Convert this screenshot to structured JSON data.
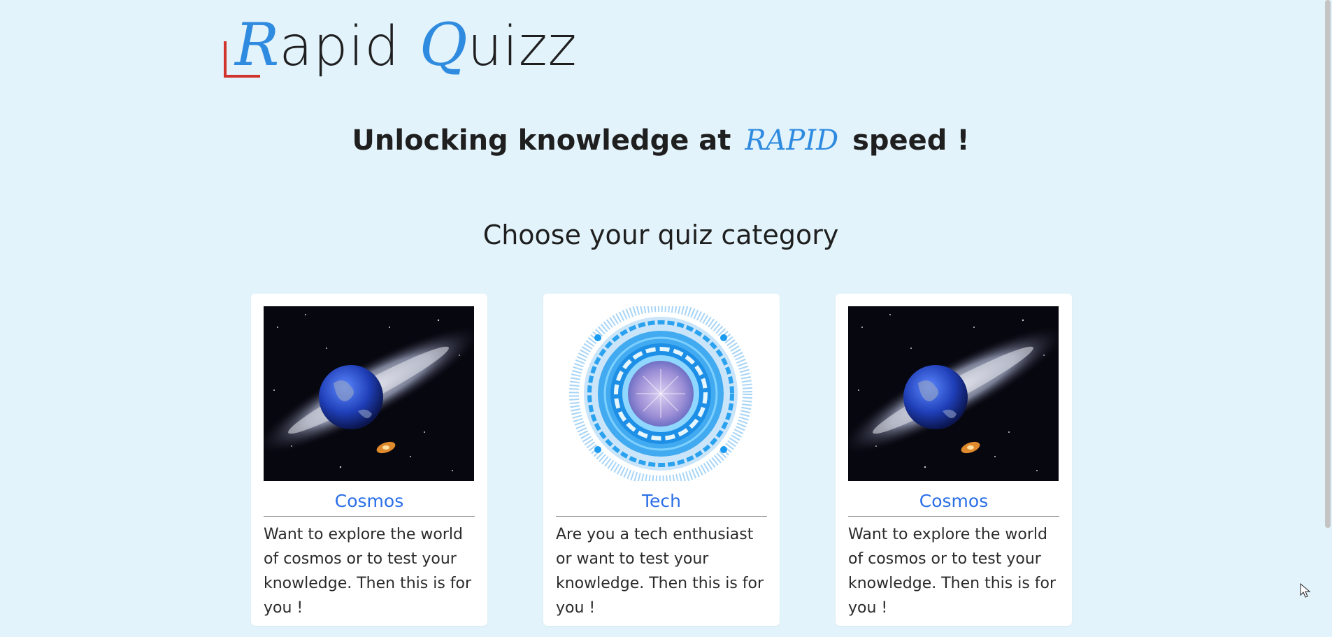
{
  "logo": {
    "first_initial": "R",
    "first_rest": "apid",
    "second_initial": "Q",
    "second_rest": "uizz"
  },
  "tagline": {
    "before": "Unlocking knowledge at",
    "accent": "RAPID",
    "after": "speed !"
  },
  "section_title": "Choose your quiz category",
  "cards": [
    {
      "title": "Cosmos",
      "image": "cosmos-image",
      "description": "Want to explore the world of cosmos or to test your knowledge. Then this is for you !"
    },
    {
      "title": "Tech",
      "image": "tech-image",
      "description": "Are you a tech enthusiast or want to test your knowledge. Then this is for you !"
    },
    {
      "title": "Cosmos",
      "image": "cosmos-image",
      "description": "Want to explore the world of cosmos or to test your knowledge. Then this is for you !"
    }
  ],
  "colors": {
    "background": "#e2f3fb",
    "accent": "#2f8be0",
    "card_title": "#2a6ee8",
    "logo_corner": "#d0342c"
  }
}
